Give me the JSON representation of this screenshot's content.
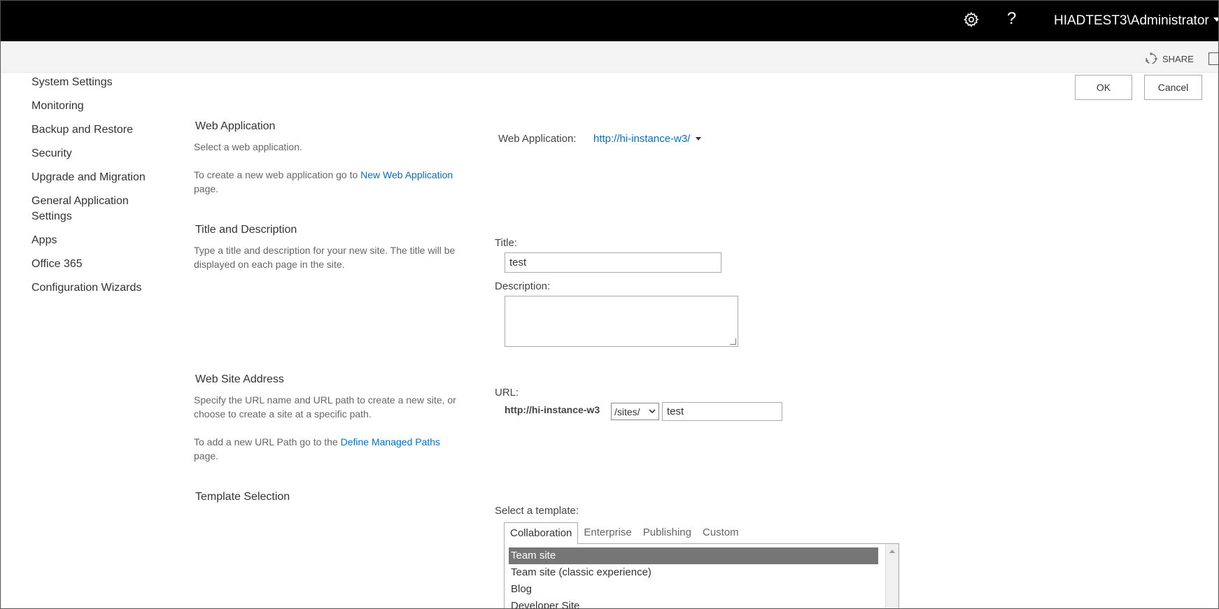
{
  "suitebar": {
    "help_label": "?",
    "user": "HIADTEST3\\Administrator"
  },
  "ribbon": {
    "share_label": "SHARE"
  },
  "nav": {
    "items": [
      "System Settings",
      "Monitoring",
      "Backup and Restore",
      "Security",
      "Upgrade and Migration",
      "General Application Settings",
      "Apps",
      "Office 365",
      "Configuration Wizards"
    ]
  },
  "buttons": {
    "ok": "OK",
    "cancel": "Cancel"
  },
  "web_application": {
    "title": "Web Application",
    "desc": "Select a web application.",
    "create_prefix": "To create a new web application go to ",
    "create_link": "New Web Application",
    "create_suffix": "page.",
    "field_label": "Web Application:",
    "value": "http://hi-instance-w3/"
  },
  "title_description": {
    "title": "Title and Description",
    "desc": "Type a title and description for your new site. The title will be displayed on each page in the site.",
    "title_label": "Title:",
    "title_value": "test",
    "description_label": "Description:",
    "description_value": ""
  },
  "web_site_address": {
    "title": "Web Site Address",
    "desc": "Specify the URL name and URL path to create a new site, or choose to create a site at a specific path.",
    "paths_prefix": "To add a new URL Path go to the ",
    "paths_link": "Define Managed Paths",
    "paths_suffix": "page.",
    "url_label": "URL:",
    "host": "http://hi-instance-w3",
    "path_selected": "/sites/",
    "site_value": "test"
  },
  "template_selection": {
    "title": "Template Selection",
    "select_label": "Select a template:",
    "tabs": [
      "Collaboration",
      "Enterprise",
      "Publishing",
      "Custom"
    ],
    "items": [
      "Team site",
      "Team site (classic experience)",
      "Blog",
      "Developer Site"
    ],
    "selected": "Team site"
  }
}
